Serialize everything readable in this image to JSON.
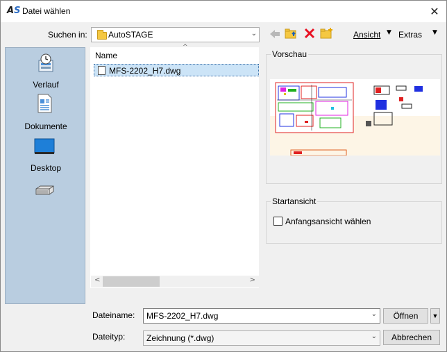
{
  "window": {
    "title": "Datei wählen",
    "logo_text_a": "A",
    "logo_text_s": "S"
  },
  "toolbar": {
    "look_in_label": "Suchen in:",
    "look_in_value": "AutoSTAGE",
    "back_icon": "back-arrow-icon",
    "up_folder_icon": "folder-up-icon",
    "delete_icon": "delete-x-icon",
    "new_folder_icon": "new-folder-icon",
    "view_label": "Ansicht",
    "extras_label": "Extras"
  },
  "places": {
    "items": [
      {
        "label": "Verlauf",
        "icon": "history-icon"
      },
      {
        "label": "Dokumente",
        "icon": "documents-icon"
      },
      {
        "label": "Desktop",
        "icon": "desktop-icon"
      },
      {
        "label": "",
        "icon": "drive-icon"
      }
    ]
  },
  "file_list": {
    "column_name": "Name",
    "files": [
      {
        "name": "MFS-2202_H7.dwg",
        "selected": true
      }
    ]
  },
  "preview": {
    "group_label": "Vorschau"
  },
  "start_view": {
    "group_label": "Startansicht",
    "checkbox_label": "Anfangsansicht wählen",
    "checked": false
  },
  "bottom": {
    "filename_label": "Dateiname:",
    "filename_value": "MFS-2202_H7.dwg",
    "filetype_label": "Dateityp:",
    "filetype_value": "Zeichnung (*.dwg)",
    "open_label": "Öffnen",
    "cancel_label": "Abbrechen"
  },
  "colors": {
    "places_bg": "#b9cde0",
    "selection_bg": "#cce4f7",
    "delete_red": "#e81123",
    "folder_yellow": "#f5c842"
  }
}
